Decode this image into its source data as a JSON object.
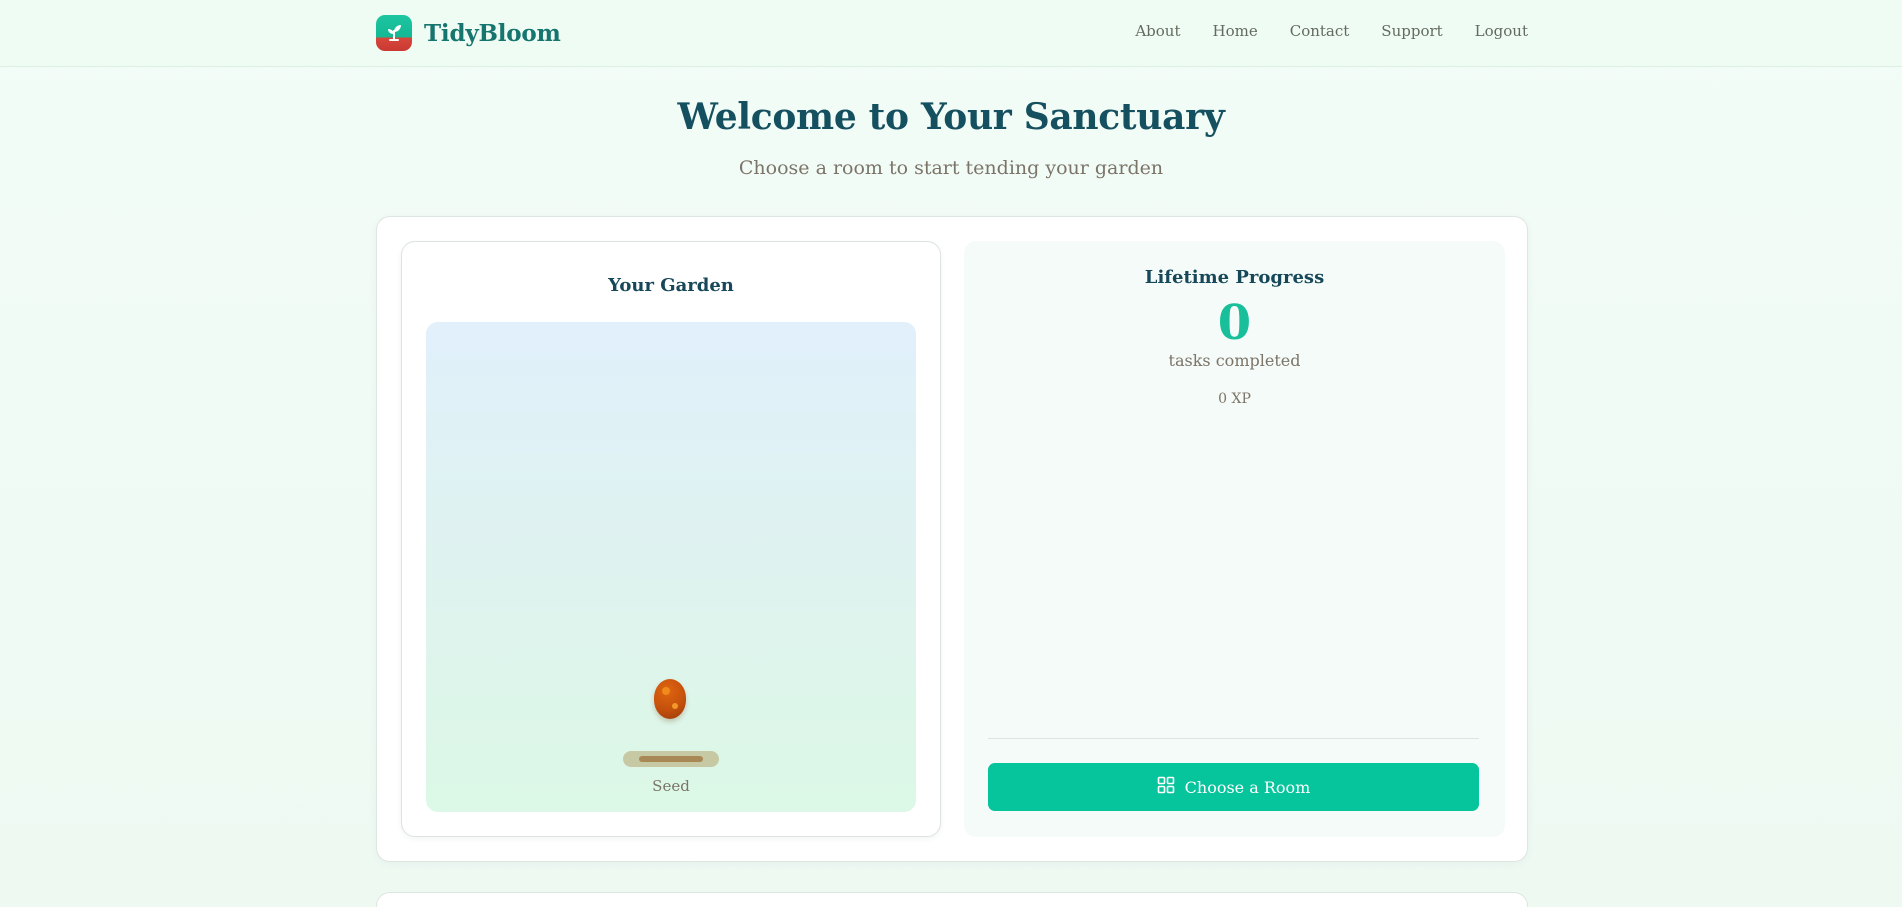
{
  "app": {
    "name": "TidyBloom"
  },
  "nav": {
    "items": [
      "About",
      "Home",
      "Contact",
      "Support",
      "Logout"
    ]
  },
  "hero": {
    "title": "Welcome to Your Sanctuary",
    "subtitle": "Choose a room to start tending your garden"
  },
  "garden": {
    "title": "Your Garden",
    "stage": "Seed"
  },
  "progress": {
    "title": "Lifetime Progress",
    "count": "0",
    "caption": "tasks completed",
    "xp": "0 XP"
  },
  "actions": {
    "choose_room": "Choose a Room"
  },
  "colors": {
    "brand": "#16756f",
    "accent": "#06c49b",
    "heading": "#14505f",
    "seed": "#c4500c",
    "logo_top": "#1cc6a0",
    "logo_bottom": "#d9473c"
  },
  "icons": {
    "logo": "sprout-icon",
    "choose_room": "grid-icon"
  }
}
